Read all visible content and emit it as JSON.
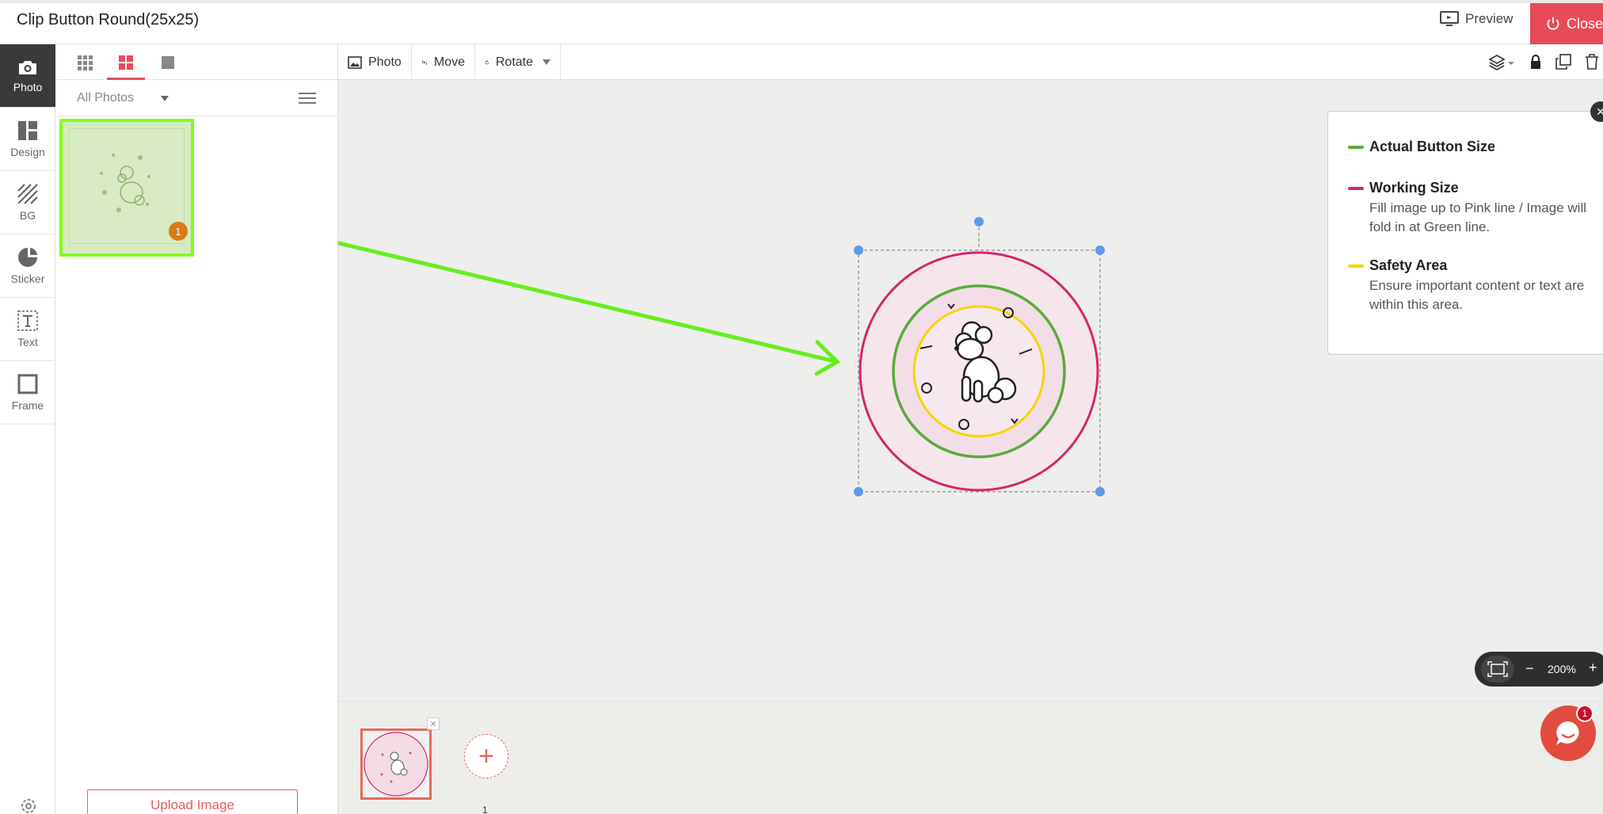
{
  "header": {
    "title": "Clip Button Round(25x25)",
    "preview_label": "Preview",
    "close_label": "Close"
  },
  "rail": {
    "items": [
      {
        "label": "Photo",
        "icon": "camera-icon"
      },
      {
        "label": "Design",
        "icon": "layout-icon"
      },
      {
        "label": "BG",
        "icon": "stripes-icon"
      },
      {
        "label": "Sticker",
        "icon": "sticker-icon"
      },
      {
        "label": "Text",
        "icon": "text-icon"
      },
      {
        "label": "Frame",
        "icon": "frame-icon"
      }
    ]
  },
  "panel": {
    "filter_label": "All Photos",
    "thumb_badge": "1",
    "upload_label": "Upload Image"
  },
  "toolbar": {
    "photo_label": "Photo",
    "move_label": "Move",
    "rotate_label": "Rotate"
  },
  "legend": {
    "items": [
      {
        "title": "Actual Button Size",
        "color": "#5aaa3c",
        "desc": ""
      },
      {
        "title": "Working Size",
        "color": "#d6246e",
        "desc": "Fill image up to Pink line / Image will fold in at Green line."
      },
      {
        "title": "Safety Area",
        "color": "#f5d400",
        "desc": "Ensure important content or text are within this area."
      }
    ]
  },
  "zoom": {
    "level": "200%"
  },
  "chat": {
    "badge": "1"
  },
  "filmstrip": {
    "page_number": "1"
  },
  "colors": {
    "accent": "#e84b56",
    "highlight": "#7fff1a",
    "working": "#d6246e",
    "actual": "#5aaa3c",
    "safety": "#f5d400"
  }
}
